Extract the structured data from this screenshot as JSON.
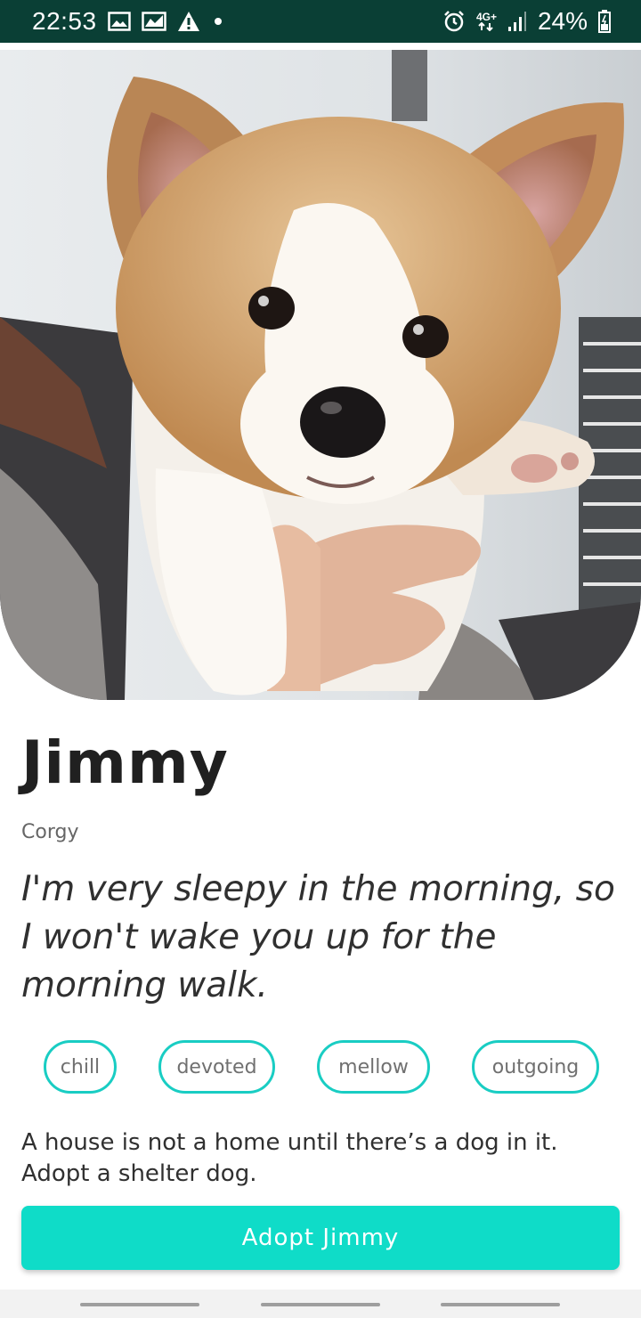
{
  "status_bar": {
    "time": "22:53",
    "network": "4G+",
    "battery": "24%",
    "left_icons": [
      "image-icon",
      "chart-icon",
      "warning-icon",
      "dot-icon"
    ],
    "right_icons": [
      "alarm-icon",
      "network-icon",
      "signal-icon",
      "battery-icon"
    ]
  },
  "pet": {
    "name": "Jimmy",
    "breed": "Corgy",
    "quote": "I'm very sleepy in the morning, so I won't wake you up for the morning walk.",
    "traits": [
      "chill",
      "devoted",
      "mellow",
      "outgoing"
    ]
  },
  "tagline": "A house is not a home until there’s a dog in it. Adopt a shelter dog.",
  "adopt_button": "Adopt Jimmy",
  "colors": {
    "status_bar": "#0a3f35",
    "accent": "#0fdcc8",
    "chip_border": "#19cdc3",
    "text_dark": "#202020"
  }
}
